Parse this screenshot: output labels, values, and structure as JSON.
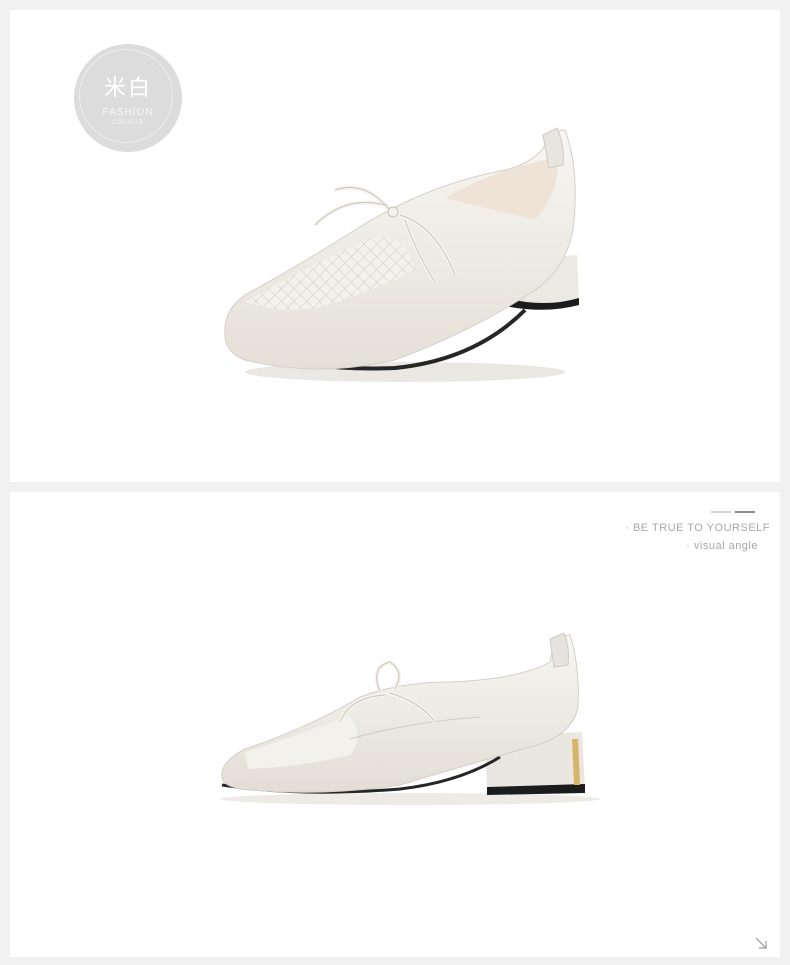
{
  "colors": {
    "background": "#f1f1f1",
    "panel": "#ffffff",
    "badge": "#dcdcdc",
    "shoe_leather": "#f1eee7",
    "text_muted": "#a8a8a8"
  },
  "top_panel": {
    "badge": {
      "title": "米白",
      "subtitle": "FASHION",
      "subtitle_small": "COLOUR"
    }
  },
  "bottom_panel": {
    "tagline": "· BE TRUE TO YOURSELF",
    "subtag": "· visual angle"
  },
  "icons": {
    "corner": "arrow-down-right-icon"
  }
}
